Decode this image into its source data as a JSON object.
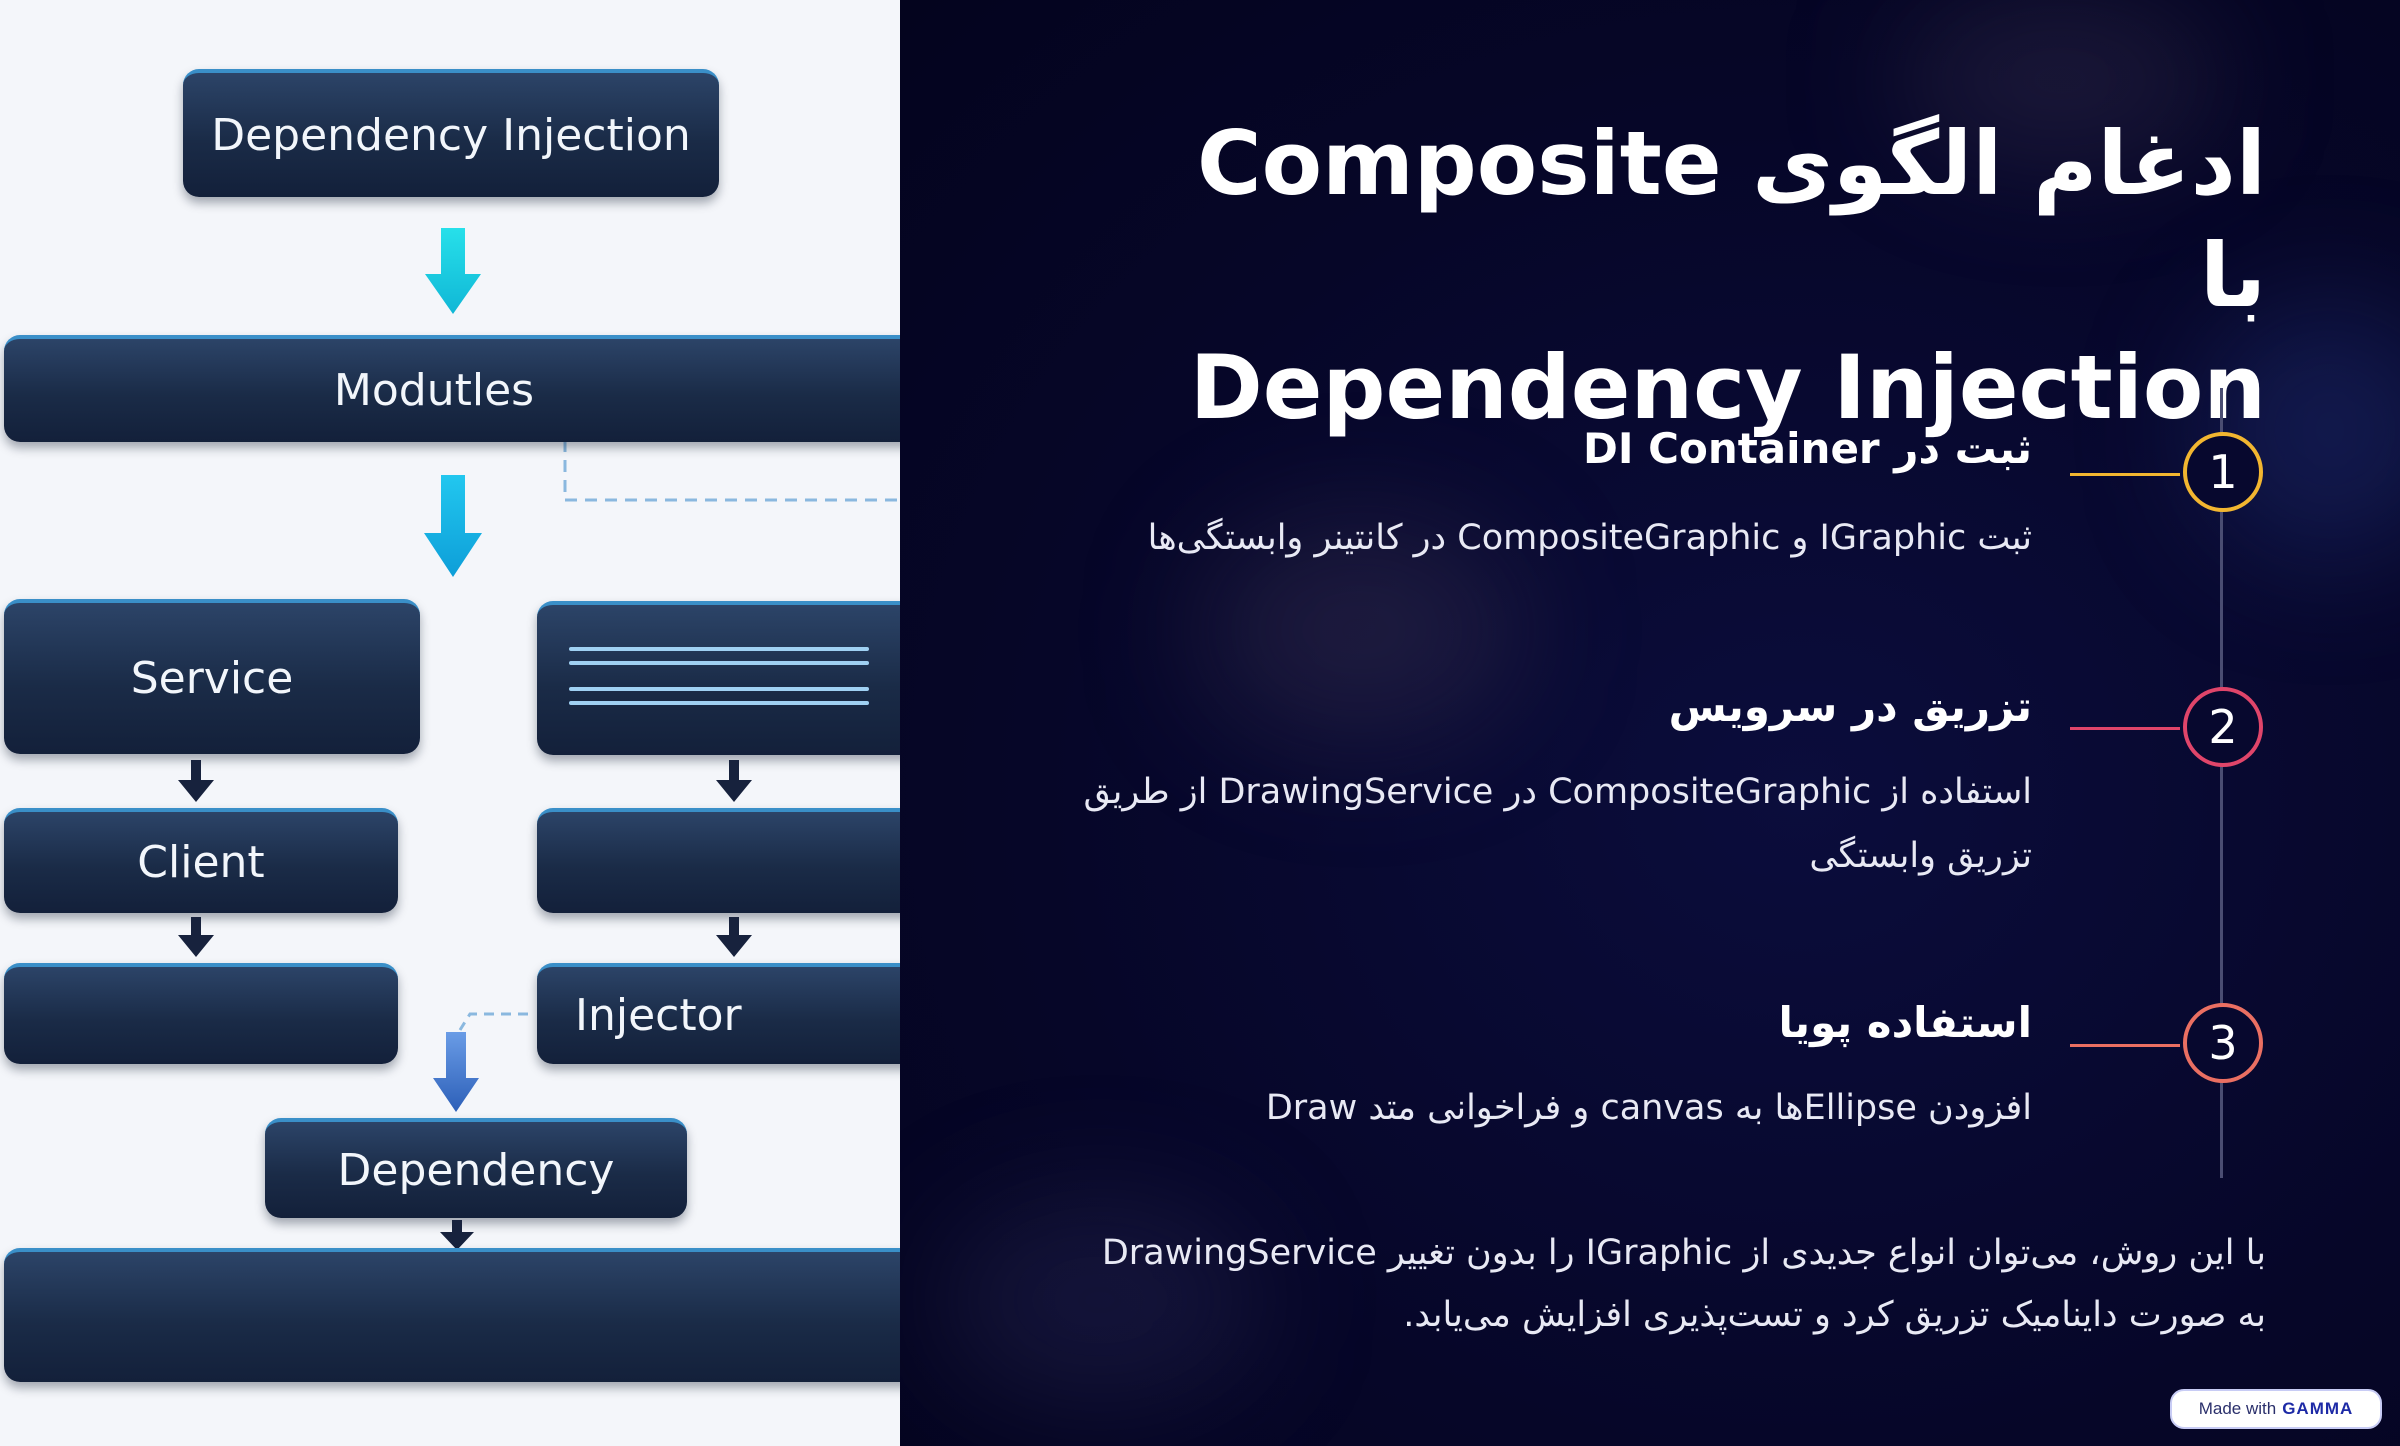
{
  "diagram": {
    "top_box": "Dependency Injection",
    "modules_box": "Modutles",
    "service_box": "Service",
    "client_box": "Client",
    "injector_box": "Injector",
    "dependency_box": "Dependency"
  },
  "slide": {
    "title_line1": "ادغام الگوی Composite با",
    "title_line2": "Dependency Injection",
    "steps": [
      {
        "number": "1",
        "title": "ثبت در DI Container",
        "description": "ثبت IGraphic و CompositeGraphic در کانتینر وابستگی‌ها",
        "color": "#f2b630"
      },
      {
        "number": "2",
        "title": "تزریق در سرویس",
        "description": "استفاده از CompositeGraphic در DrawingService از طریق تزریق وابستگی",
        "color": "#e0456a"
      },
      {
        "number": "3",
        "title": "استفاده پویا",
        "description": "افزودن Ellipseها به canvas و فراخوانی متد Draw",
        "color": "#ea6f62"
      }
    ],
    "footer": "با این روش، می‌توان انواع جدیدی از IGraphic را بدون تغییر DrawingService به صورت داینامیک تزریق کرد و تست‌پذیری افزایش می‌یابد."
  },
  "badge": {
    "prefix": "Made with",
    "brand": "GAMMA"
  }
}
